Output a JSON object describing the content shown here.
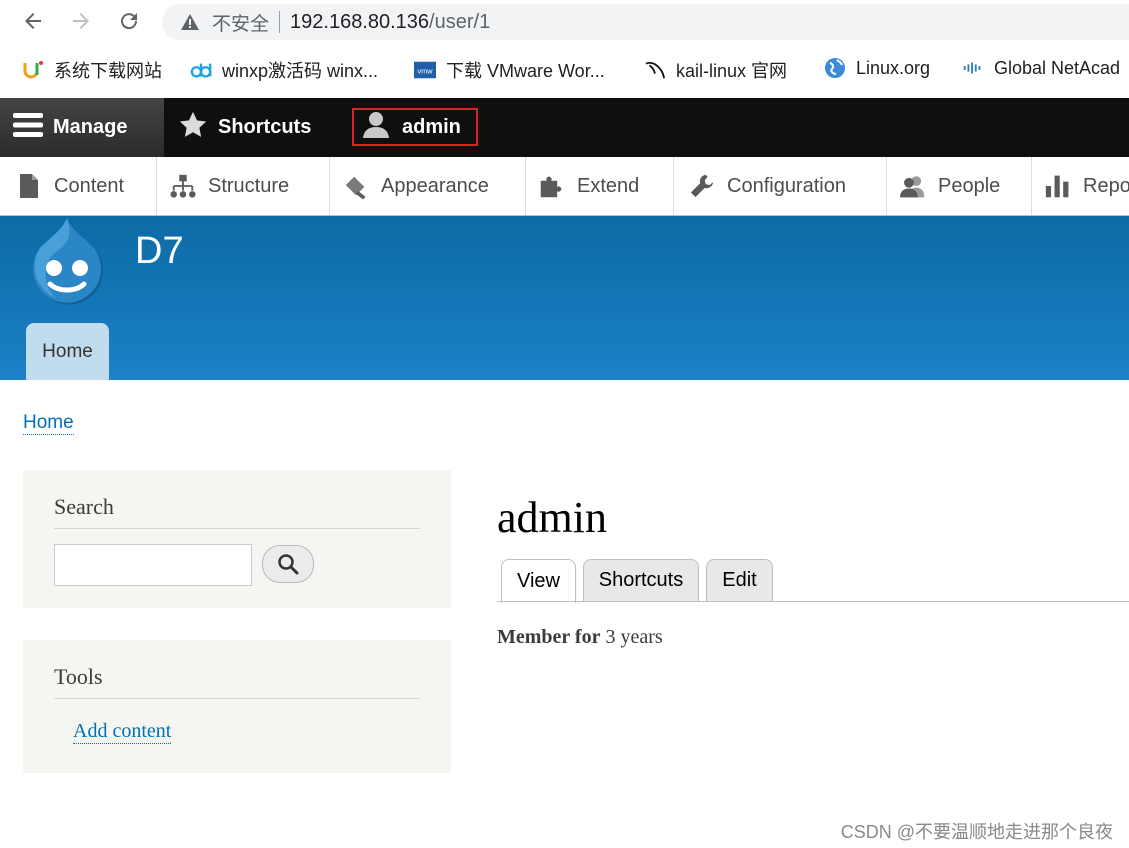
{
  "browser": {
    "insecure_label": "不安全",
    "url_host": "192.168.80.136",
    "url_path": "/user/1",
    "bookmarks": [
      {
        "label": "系统下载网站",
        "icon": "u-logo-icon"
      },
      {
        "label": "winxp激活码 winx...",
        "icon": "dd-logo-icon"
      },
      {
        "label": "下载 VMware Wor...",
        "icon": "vmware-icon"
      },
      {
        "label": "kail-linux 官网",
        "icon": "kali-dragon-icon"
      },
      {
        "label": "Linux.org",
        "icon": "globe-icon"
      },
      {
        "label": "Global NetAcad",
        "icon": "cisco-icon"
      }
    ]
  },
  "toolbar": {
    "manage": "Manage",
    "shortcuts": "Shortcuts",
    "user": "admin",
    "tray": [
      {
        "label": "Content",
        "icon": "file-icon"
      },
      {
        "label": "Structure",
        "icon": "sitemap-icon"
      },
      {
        "label": "Appearance",
        "icon": "paintbrush-icon"
      },
      {
        "label": "Extend",
        "icon": "puzzle-icon"
      },
      {
        "label": "Configuration",
        "icon": "wrench-icon"
      },
      {
        "label": "People",
        "icon": "people-icon"
      },
      {
        "label": "Reports",
        "icon": "bar-chart-icon"
      }
    ]
  },
  "header": {
    "site_name": "D7",
    "primary_tab": "Home"
  },
  "breadcrumb": {
    "home": "Home"
  },
  "sidebar": {
    "search_title": "Search",
    "tools_title": "Tools",
    "add_content": "Add content"
  },
  "main": {
    "title": "admin",
    "tabs": [
      "View",
      "Shortcuts",
      "Edit"
    ],
    "member_label": "Member for",
    "member_value": "3 years"
  },
  "watermark": "CSDN @不要温顺地走进那个良夜",
  "colors": {
    "toolbar": "#0f0f0f",
    "header_blue": "#1a82c6",
    "link": "#0071b3",
    "highlight_border": "#e02020"
  }
}
